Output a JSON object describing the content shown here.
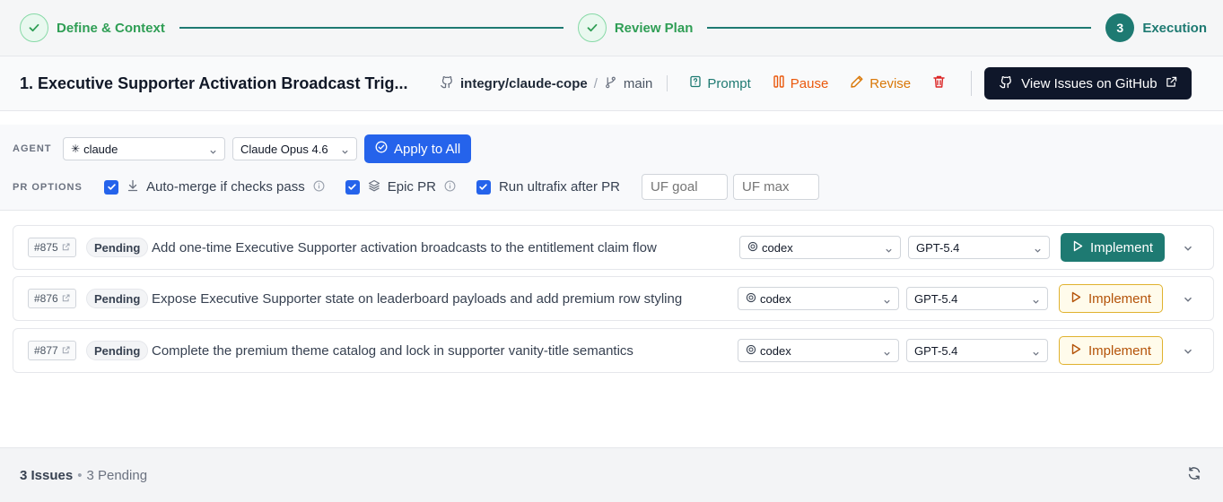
{
  "stepper": {
    "steps": [
      {
        "label": "Define & Context",
        "state": "done"
      },
      {
        "label": "Review Plan",
        "state": "done"
      },
      {
        "number": "3",
        "label": "Execution",
        "state": "current"
      }
    ]
  },
  "header": {
    "title": "1. Executive Supporter Activation Broadcast Trig...",
    "repo": "integry/claude-cope",
    "repo_separator": "/",
    "branch": "main",
    "prompt_label": "Prompt",
    "pause_label": "Pause",
    "revise_label": "Revise",
    "github_label": "View Issues on GitHub"
  },
  "options": {
    "agent_label": "AGENT",
    "agent_value": "claude",
    "model_value": "Claude Opus 4.6",
    "apply_label": "Apply to All",
    "pr_label": "PR OPTIONS",
    "automerge_label": "Auto-merge if checks pass",
    "automerge_checked": true,
    "epic_label": "Epic PR",
    "epic_checked": true,
    "ultrafix_label": "Run ultrafix after PR",
    "ultrafix_checked": true,
    "uf_goal_placeholder": "UF goal",
    "uf_max_placeholder": "UF max"
  },
  "issues": [
    {
      "number": "#875",
      "status": "Pending",
      "title": "Add one-time Executive Supporter activation broadcasts to the entitlement claim flow",
      "agent": "codex",
      "model": "GPT-5.4",
      "action": "Implement",
      "primary": true
    },
    {
      "number": "#876",
      "status": "Pending",
      "title": "Expose Executive Supporter state on leaderboard payloads and add premium row styling",
      "agent": "codex",
      "model": "GPT-5.4",
      "action": "Implement",
      "primary": false
    },
    {
      "number": "#877",
      "status": "Pending",
      "title": "Complete the premium theme catalog and lock in supporter vanity-title semantics",
      "agent": "codex",
      "model": "GPT-5.4",
      "action": "Implement",
      "primary": false
    }
  ],
  "footer": {
    "issues_count": "3 Issues",
    "separator": "•",
    "pending_count": "3 Pending"
  },
  "colors": {
    "teal": "#1e7a72",
    "green": "#2f9e55",
    "blue": "#2563eb",
    "orange": "#ea580c",
    "amber": "#d97706",
    "red": "#dc2626",
    "dark": "#0f172a"
  }
}
